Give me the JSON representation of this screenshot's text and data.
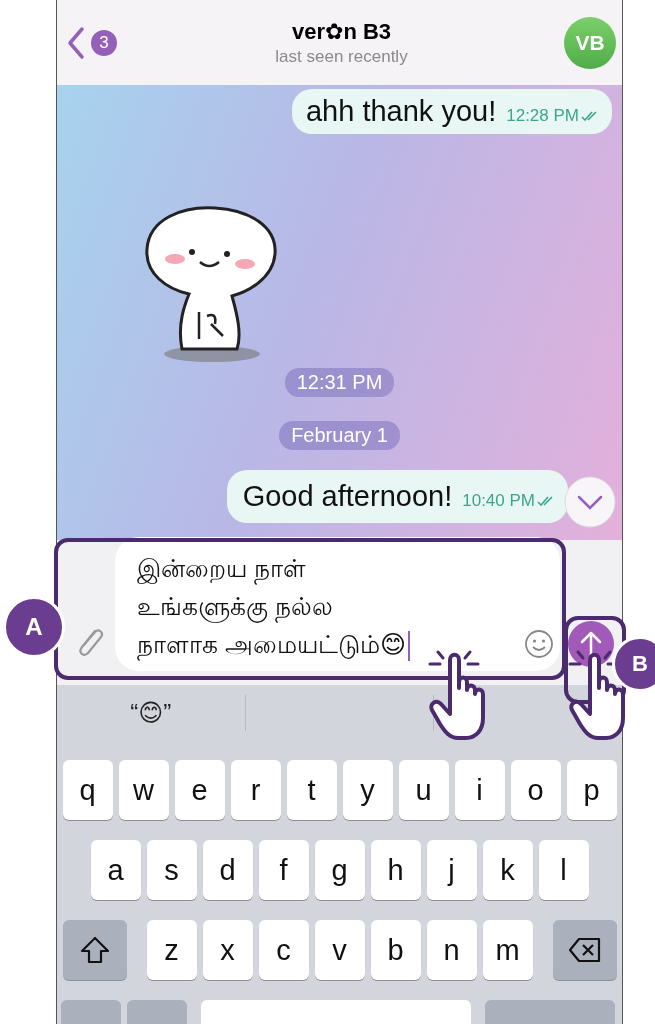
{
  "header": {
    "back_badge": "3",
    "title": "ver✿n B3",
    "subtitle": "last seen recently",
    "avatar_initials": "VB"
  },
  "messages": [
    {
      "kind": "text",
      "text": "ahh thank you!",
      "time": "12:28 PM",
      "read": true
    },
    {
      "kind": "sticker"
    },
    {
      "kind": "service",
      "text": "12:31 PM"
    },
    {
      "kind": "service",
      "text": "February 1"
    },
    {
      "kind": "text",
      "text": "Good afternoon!",
      "time": "10:40 PM",
      "read": true
    }
  ],
  "composer": {
    "value": "இன்றைய நாள்\nஉங்களுக்கு நல்ல\nநாளாக அமையட்டும்😊"
  },
  "suggestions": [
    "“😊”"
  ],
  "keyboard": {
    "rows": [
      [
        {
          "kind": "letter",
          "label": "q"
        },
        {
          "kind": "letter",
          "label": "w"
        },
        {
          "kind": "letter",
          "label": "e"
        },
        {
          "kind": "letter",
          "label": "r"
        },
        {
          "kind": "letter",
          "label": "t"
        },
        {
          "kind": "letter",
          "label": "y"
        },
        {
          "kind": "letter",
          "label": "u"
        },
        {
          "kind": "letter",
          "label": "i"
        },
        {
          "kind": "letter",
          "label": "o"
        },
        {
          "kind": "letter",
          "label": "p"
        }
      ],
      [
        {
          "kind": "letter",
          "label": "a"
        },
        {
          "kind": "letter",
          "label": "s"
        },
        {
          "kind": "letter",
          "label": "d"
        },
        {
          "kind": "letter",
          "label": "f"
        },
        {
          "kind": "letter",
          "label": "g"
        },
        {
          "kind": "letter",
          "label": "h"
        },
        {
          "kind": "letter",
          "label": "j"
        },
        {
          "kind": "letter",
          "label": "k"
        },
        {
          "kind": "letter",
          "label": "l"
        }
      ],
      [
        {
          "kind": "shift"
        },
        {
          "kind": "letter",
          "label": "z"
        },
        {
          "kind": "letter",
          "label": "x"
        },
        {
          "kind": "letter",
          "label": "c"
        },
        {
          "kind": "letter",
          "label": "v"
        },
        {
          "kind": "letter",
          "label": "b"
        },
        {
          "kind": "letter",
          "label": "n"
        },
        {
          "kind": "letter",
          "label": "m"
        },
        {
          "kind": "backspace"
        }
      ],
      [
        {
          "kind": "blank"
        },
        {
          "kind": "blank"
        },
        {
          "kind": "space"
        },
        {
          "kind": "wide"
        }
      ]
    ]
  },
  "annotations": [
    {
      "label": "A"
    },
    {
      "label": "B"
    }
  ]
}
